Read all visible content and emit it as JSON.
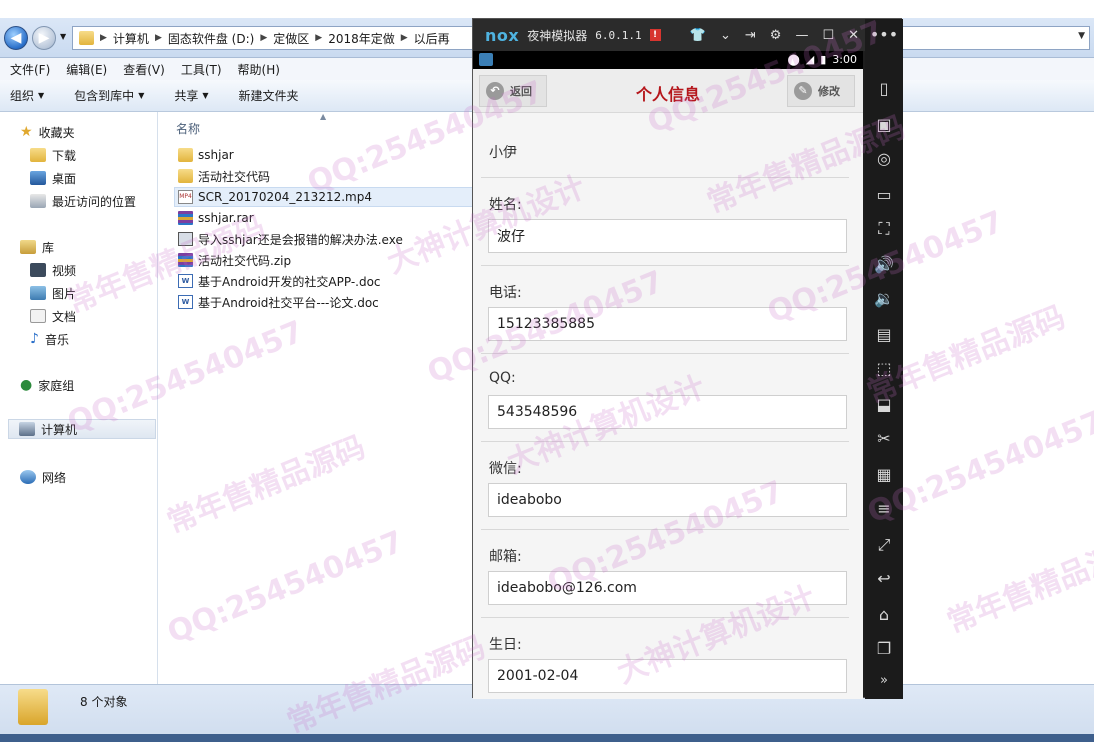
{
  "explorer": {
    "breadcrumb": [
      "计算机",
      "固态软件盘 (D:)",
      "定做区",
      "2018年定做",
      "以后再"
    ],
    "menu": [
      "文件(F)",
      "编辑(E)",
      "查看(V)",
      "工具(T)",
      "帮助(H)"
    ],
    "toolbar": [
      "组织",
      "包含到库中",
      "共享",
      "新建文件夹"
    ],
    "nav": {
      "favorites": "收藏夹",
      "downloads": "下载",
      "desktop": "桌面",
      "recent": "最近访问的位置",
      "libraries": "库",
      "videos": "视频",
      "pictures": "图片",
      "documents": "文档",
      "music": "音乐",
      "homegroup": "家庭组",
      "computer": "计算机",
      "network": "网络"
    },
    "column_name": "名称",
    "files": [
      {
        "name": "sshjar",
        "icon": "folder-icon"
      },
      {
        "name": "活动社交代码",
        "icon": "folder-icon"
      },
      {
        "name": "SCR_20170204_213212.mp4",
        "icon": "video-file-icon"
      },
      {
        "name": "sshjar.rar",
        "icon": "rar-icon"
      },
      {
        "name": "导入sshjar还是会报错的解决办法.exe",
        "icon": "exe-icon"
      },
      {
        "name": "活动社交代码.zip",
        "icon": "rar-icon"
      },
      {
        "name": "基于Android开发的社交APP-.doc",
        "icon": "doc-icon"
      },
      {
        "name": "基于Android社交平台---论文.doc",
        "icon": "doc-icon"
      }
    ],
    "status_count": "8 个对象"
  },
  "emulator": {
    "logo": "nox",
    "name": "夜神模拟器",
    "version": "6.0.1.1",
    "clock": "3:00"
  },
  "app": {
    "back_label": "返回",
    "title": "个人信息",
    "edit_label": "修改",
    "username": "小伊",
    "fields": [
      {
        "label": "姓名:",
        "value": "波仔"
      },
      {
        "label": "电话:",
        "value": "15123385885"
      },
      {
        "label": "QQ:",
        "value": "543548596"
      },
      {
        "label": "微信:",
        "value": "ideabobo"
      },
      {
        "label": "邮箱:",
        "value": "ideabobo@126.com"
      },
      {
        "label": "生日:",
        "value": "2001-02-04"
      }
    ]
  },
  "watermarks": [
    "QQ:254540457",
    "大神计算机设计",
    "常年售精品源码"
  ],
  "colors": {
    "accent_red": "#b5161b",
    "nox_blue": "#4fb3e0",
    "explorer_bg": "#dbe7f7"
  }
}
